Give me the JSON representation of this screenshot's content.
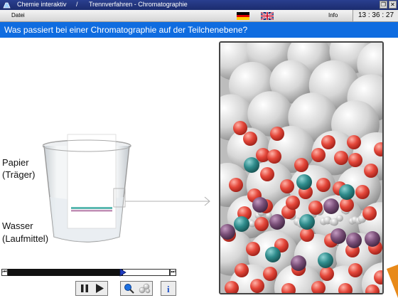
{
  "titlebar": {
    "app_name": "Chemie interaktiv",
    "separator": "/",
    "section": "Trennverfahren - Chromatographie"
  },
  "menubar": {
    "file_label": "Datei",
    "info_label": "Info",
    "clock": "13 : 36 : 27"
  },
  "question": "Was passiert bei einer Chromatographie auf der Teilchenebene?",
  "labels": {
    "paper_line1": "Papier",
    "paper_line2": "(Träger)",
    "water_line1": "Wasser",
    "water_line2": "(Laufmittel)"
  },
  "timeline": {
    "progress": 0.71
  },
  "colors": {
    "titlebar": "#1b2c6e",
    "question_bar": "#0f6ce0",
    "particle_red": "#e0473a",
    "particle_teal": "#2f8c8c",
    "particle_purple": "#7a4f78",
    "sphere_grey": "#d9d9d9"
  },
  "icons": [
    "app-icon",
    "flag-de-icon",
    "flag-uk-icon",
    "restore-icon",
    "close-icon",
    "pause-icon",
    "play-icon",
    "zoom-icon",
    "particles-icon",
    "info-icon"
  ]
}
